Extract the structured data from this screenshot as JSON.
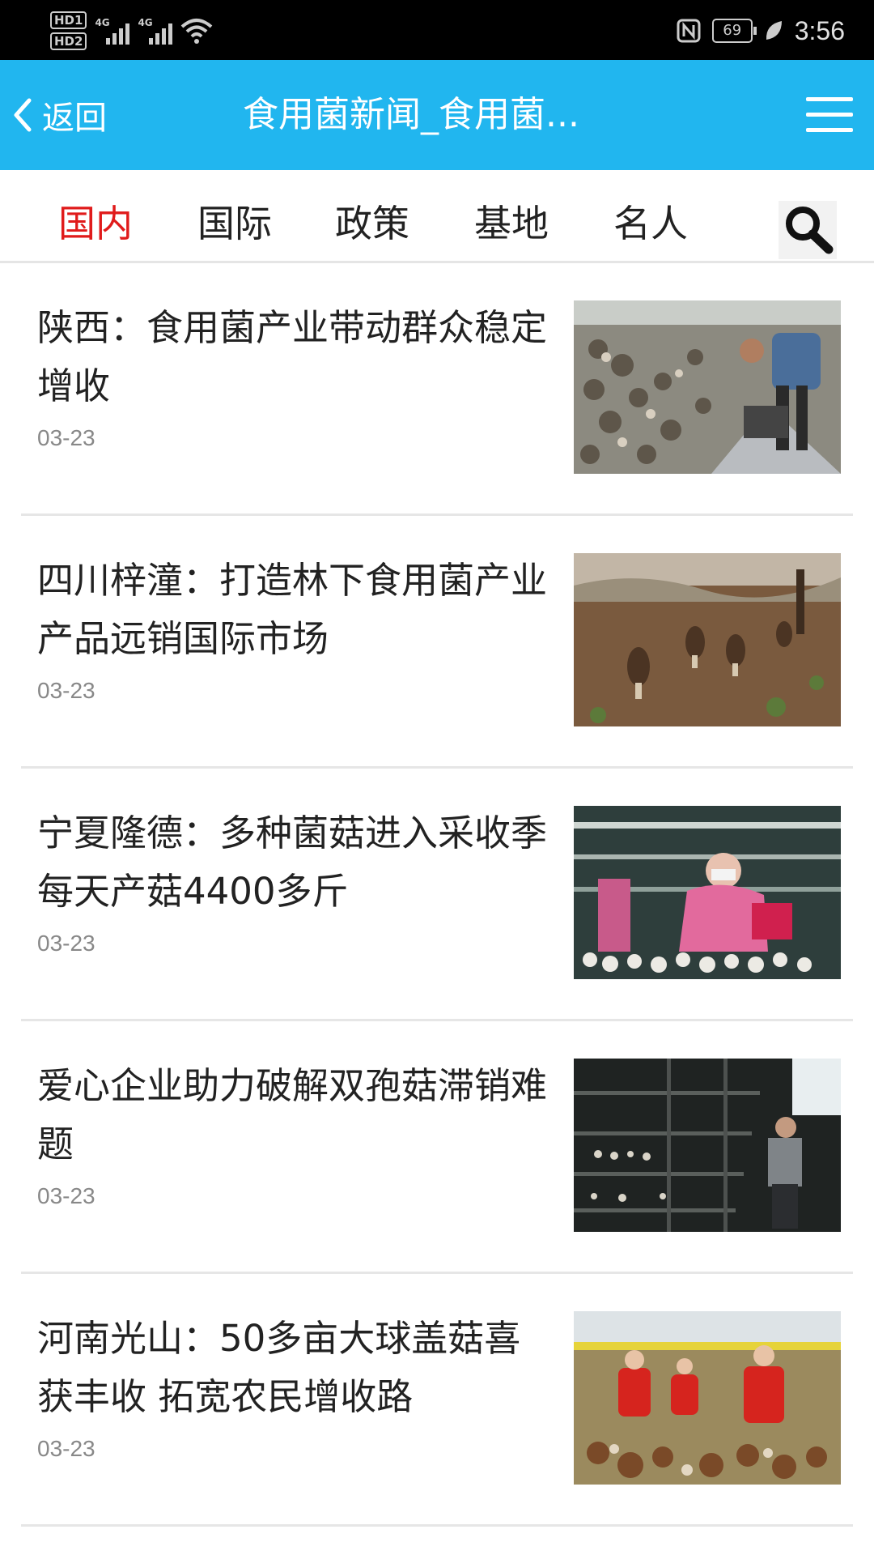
{
  "status_bar": {
    "hd_badges": [
      "HD1",
      "HD2"
    ],
    "network_labels": [
      "4G",
      "4G"
    ],
    "battery_level": "69",
    "time": "3:56"
  },
  "header": {
    "back_label": "返回",
    "title": "食用菌新闻_食用菌...",
    "back_icon": "chevron-left-icon",
    "menu_icon": "hamburger-menu-icon",
    "background_color": "#21b6ef"
  },
  "tabs": [
    {
      "label": "国内",
      "active": true
    },
    {
      "label": "国际",
      "active": false
    },
    {
      "label": "政策",
      "active": false
    },
    {
      "label": "基地",
      "active": false
    },
    {
      "label": "名人",
      "active": false
    }
  ],
  "active_tab_color": "#e01b1b",
  "search_icon": "search-icon",
  "articles": [
    {
      "title": "陕西：食用菌产业带动群众稳定增收",
      "date": "03-23"
    },
    {
      "title": "四川梓潼：打造林下食用菌产业 产品远销国际市场",
      "date": "03-23"
    },
    {
      "title": "宁夏隆德：多种菌菇进入采收季 每天产菇4400多斤",
      "date": "03-23"
    },
    {
      "title": "爱心企业助力破解双孢菇滞销难题",
      "date": "03-23"
    },
    {
      "title": "河南光山：50多亩大球盖菇喜获丰收 拓宽农民增收路",
      "date": "03-23"
    }
  ]
}
